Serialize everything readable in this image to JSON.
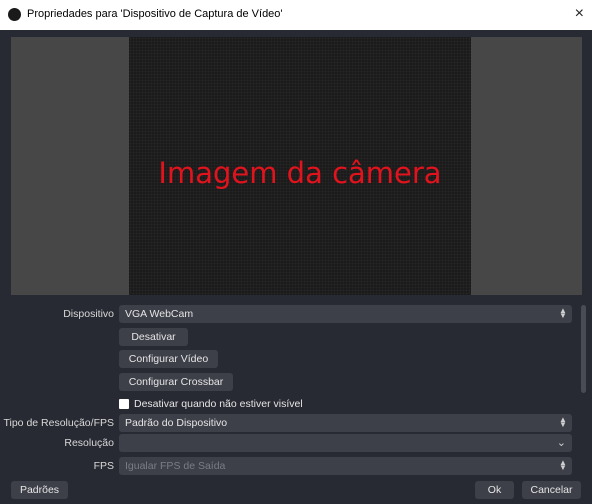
{
  "window": {
    "title": "Propriedades para 'Dispositivo de Captura de Vídeo'",
    "close_glyph": "×"
  },
  "preview": {
    "camera_text": "Imagem da câmera",
    "camera_text_color": "#e1131d"
  },
  "properties": {
    "device_label": "Dispositivo",
    "device_value": "VGA WebCam",
    "deactivate_button": "Desativar",
    "configure_video_button": "Configurar Vídeo",
    "configure_crossbar_button": "Configurar Crossbar",
    "deactivate_when_hidden_label": "Desativar quando não estiver visível",
    "deactivate_when_hidden_checked": false,
    "resolution_fps_type_label": "Tipo de Resolução/FPS",
    "resolution_fps_type_value": "Padrão do Dispositivo",
    "resolution_label": "Resolução",
    "resolution_value": "",
    "fps_label": "FPS",
    "fps_value": "Igualar FPS de Saída"
  },
  "footer": {
    "defaults_button": "Padrões",
    "ok_button": "Ok",
    "cancel_button": "Cancelar"
  },
  "icons": {
    "app": "obs-logo-icon",
    "spin": "spin-updown-icon",
    "dropdown": "chevron-down-icon"
  }
}
